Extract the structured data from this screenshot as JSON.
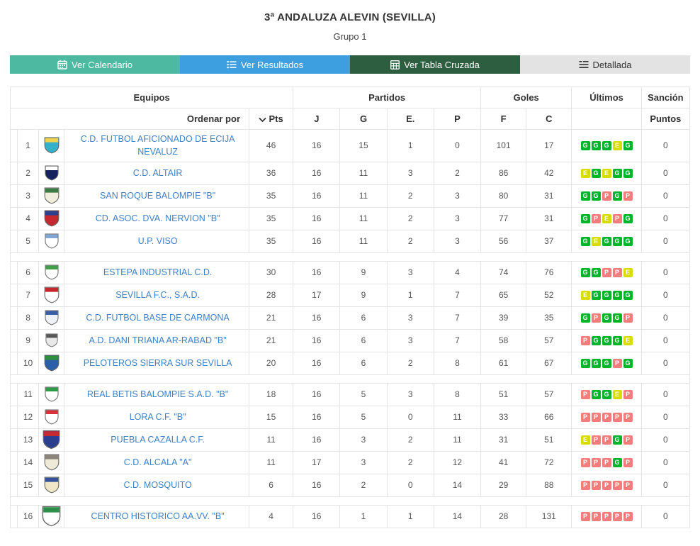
{
  "header": {
    "title": "3ª ANDALUZA ALEVIN (SEVILLA)",
    "subtitle": "Grupo 1"
  },
  "tabs": [
    {
      "label": "Ver Calendario",
      "icon": "calendar-icon",
      "bg": "#4cb9a0",
      "color": "#ffffff"
    },
    {
      "label": "Ver Resultados",
      "icon": "list-icon",
      "bg": "#3d9fe0",
      "color": "#ffffff"
    },
    {
      "label": "Ver Tabla Cruzada",
      "icon": "table-grid-icon",
      "bg": "#2d5e40",
      "color": "#ffffff"
    },
    {
      "label": "Detallada",
      "icon": "detail-list-icon",
      "bg": "#e3e3e3",
      "color": "#333333"
    }
  ],
  "table": {
    "group_headers": {
      "equipos": "Equipos",
      "partidos": "Partidos",
      "goles": "Goles",
      "ultimos": "Últimos",
      "sancion": "Sanción"
    },
    "sub_headers": {
      "ordenar": "Ordenar por",
      "pts": "Pts",
      "j": "J",
      "g": "G",
      "e": "E.",
      "p": "P",
      "f": "F",
      "c": "C",
      "puntos": "Puntos"
    },
    "result_colors": {
      "G": "#00b52c",
      "E": "#d8dd00",
      "P": "#f47c7c"
    },
    "link_color": "#4080c4",
    "rows": [
      {
        "pos": 1,
        "team": "C.D. FUTBOL AFICIONADO DE ECIJA NEVALUZ",
        "crest": [
          "#35b0c9",
          "#f0d34f"
        ],
        "crest_h": 24,
        "pts": 46,
        "j": 16,
        "g": 15,
        "e": 1,
        "p": 0,
        "f": 101,
        "c": 17,
        "last5": [
          "G",
          "G",
          "G",
          "E",
          "G"
        ],
        "sancion": 0,
        "spacer_after": false
      },
      {
        "pos": 2,
        "team": "C.D. ALTAIR",
        "crest": [
          "#16225e",
          "#ffffff"
        ],
        "crest_h": 22,
        "pts": 36,
        "j": 16,
        "g": 11,
        "e": 3,
        "p": 2,
        "f": 86,
        "c": 42,
        "last5": [
          "E",
          "G",
          "E",
          "G",
          "G"
        ],
        "sancion": 0,
        "spacer_after": false
      },
      {
        "pos": 3,
        "team": "SAN ROQUE BALOMPIE \"B\"",
        "crest": [
          "#f2eedd",
          "#3c7a44"
        ],
        "crest_h": 24,
        "pts": 35,
        "j": 16,
        "g": 11,
        "e": 2,
        "p": 3,
        "f": 80,
        "c": 31,
        "last5": [
          "G",
          "G",
          "P",
          "G",
          "P"
        ],
        "sancion": 0,
        "spacer_after": false
      },
      {
        "pos": 4,
        "team": "CD. ASOC. DVA. NERVION \"B\"",
        "crest": [
          "#c62830",
          "#2b3f8f"
        ],
        "crest_h": 24,
        "pts": 35,
        "j": 16,
        "g": 11,
        "e": 2,
        "p": 3,
        "f": 77,
        "c": 31,
        "last5": [
          "G",
          "P",
          "E",
          "P",
          "G"
        ],
        "sancion": 0,
        "spacer_after": false
      },
      {
        "pos": 5,
        "team": "U.P. VISO",
        "crest": [
          "#ffffff",
          "#7fa8d8"
        ],
        "crest_h": 22,
        "pts": 35,
        "j": 16,
        "g": 11,
        "e": 2,
        "p": 3,
        "f": 56,
        "c": 37,
        "last5": [
          "G",
          "E",
          "G",
          "G",
          "G"
        ],
        "sancion": 0,
        "spacer_after": true
      },
      {
        "pos": 6,
        "team": "ESTEPA INDUSTRIAL C.D.",
        "crest": [
          "#ffffff",
          "#3fa04a"
        ],
        "crest_h": 22,
        "pts": 30,
        "j": 16,
        "g": 9,
        "e": 3,
        "p": 4,
        "f": 74,
        "c": 76,
        "last5": [
          "G",
          "G",
          "P",
          "P",
          "E"
        ],
        "sancion": 0,
        "spacer_after": false
      },
      {
        "pos": 7,
        "team": "SEVILLA F.C., S.A.D.",
        "crest": [
          "#ffffff",
          "#c5262c"
        ],
        "crest_h": 24,
        "pts": 28,
        "j": 17,
        "g": 9,
        "e": 1,
        "p": 7,
        "f": 65,
        "c": 52,
        "last5": [
          "E",
          "G",
          "G",
          "G",
          "G"
        ],
        "sancion": 0,
        "spacer_after": false
      },
      {
        "pos": 8,
        "team": "C.D. FUTBOL BASE DE CARMONA",
        "crest": [
          "#eef1f5",
          "#3a5da8"
        ],
        "crest_h": 22,
        "pts": 21,
        "j": 16,
        "g": 6,
        "e": 3,
        "p": 7,
        "f": 39,
        "c": 35,
        "last5": [
          "G",
          "P",
          "G",
          "G",
          "P"
        ],
        "sancion": 0,
        "spacer_after": false
      },
      {
        "pos": 9,
        "team": "A.D. DANI TRIANA AR-RABAD \"B\"",
        "crest": [
          "#e9e9e9",
          "#555555"
        ],
        "crest_h": 20,
        "pts": 21,
        "j": 16,
        "g": 6,
        "e": 3,
        "p": 7,
        "f": 58,
        "c": 57,
        "last5": [
          "P",
          "G",
          "G",
          "G",
          "E"
        ],
        "sancion": 0,
        "spacer_after": false
      },
      {
        "pos": 10,
        "team": "PELOTEROS SIERRA SUR SEVILLA",
        "crest": [
          "#2b5fa8",
          "#2f8f3e"
        ],
        "crest_h": 24,
        "pts": 20,
        "j": 16,
        "g": 6,
        "e": 2,
        "p": 8,
        "f": 61,
        "c": 67,
        "last5": [
          "G",
          "G",
          "G",
          "P",
          "G"
        ],
        "sancion": 0,
        "spacer_after": true
      },
      {
        "pos": 11,
        "team": "REAL BETIS BALOMPIE S.A.D. \"B\"",
        "crest": [
          "#ffffff",
          "#2e9b45"
        ],
        "crest_h": 22,
        "pts": 18,
        "j": 16,
        "g": 5,
        "e": 3,
        "p": 8,
        "f": 51,
        "c": 57,
        "last5": [
          "P",
          "G",
          "G",
          "E",
          "P"
        ],
        "sancion": 0,
        "spacer_after": false
      },
      {
        "pos": 12,
        "team": "LORA C.F. \"B\"",
        "crest": [
          "#ffffff",
          "#d6333b"
        ],
        "crest_h": 22,
        "pts": 15,
        "j": 16,
        "g": 5,
        "e": 0,
        "p": 11,
        "f": 33,
        "c": 66,
        "last5": [
          "P",
          "P",
          "P",
          "P",
          "P"
        ],
        "sancion": 0,
        "spacer_after": false
      },
      {
        "pos": 13,
        "team": "PUEBLA CAZALLA C.F.",
        "crest": [
          "#2b3f8f",
          "#c52a33"
        ],
        "crest_h": 28,
        "pts": 11,
        "j": 16,
        "g": 3,
        "e": 2,
        "p": 11,
        "f": 31,
        "c": 51,
        "last5": [
          "E",
          "P",
          "P",
          "G",
          "P"
        ],
        "sancion": 0,
        "spacer_after": false
      },
      {
        "pos": 14,
        "team": "C.D. ALCALA \"A\"",
        "crest": [
          "#efe9d8",
          "#8a857a"
        ],
        "crest_h": 24,
        "pts": 11,
        "j": 17,
        "g": 3,
        "e": 2,
        "p": 12,
        "f": 41,
        "c": 72,
        "last5": [
          "P",
          "P",
          "P",
          "G",
          "P"
        ],
        "sancion": 0,
        "spacer_after": false
      },
      {
        "pos": 15,
        "team": "C.D. MOSQUITO",
        "crest": [
          "#f0e6c8",
          "#34539c"
        ],
        "crest_h": 24,
        "pts": 6,
        "j": 16,
        "g": 2,
        "e": 0,
        "p": 14,
        "f": 29,
        "c": 88,
        "last5": [
          "P",
          "P",
          "P",
          "P",
          "P"
        ],
        "sancion": 0,
        "spacer_after": true
      },
      {
        "pos": 16,
        "team": "CENTRO HISTORICO AA.VV. \"B\"",
        "crest": [
          "#ffffff",
          "#2e8f4a"
        ],
        "crest_h": 30,
        "pts": 4,
        "j": 16,
        "g": 1,
        "e": 1,
        "p": 14,
        "f": 28,
        "c": 131,
        "last5": [
          "P",
          "P",
          "P",
          "P",
          "P"
        ],
        "sancion": 0,
        "spacer_after": false
      }
    ]
  }
}
